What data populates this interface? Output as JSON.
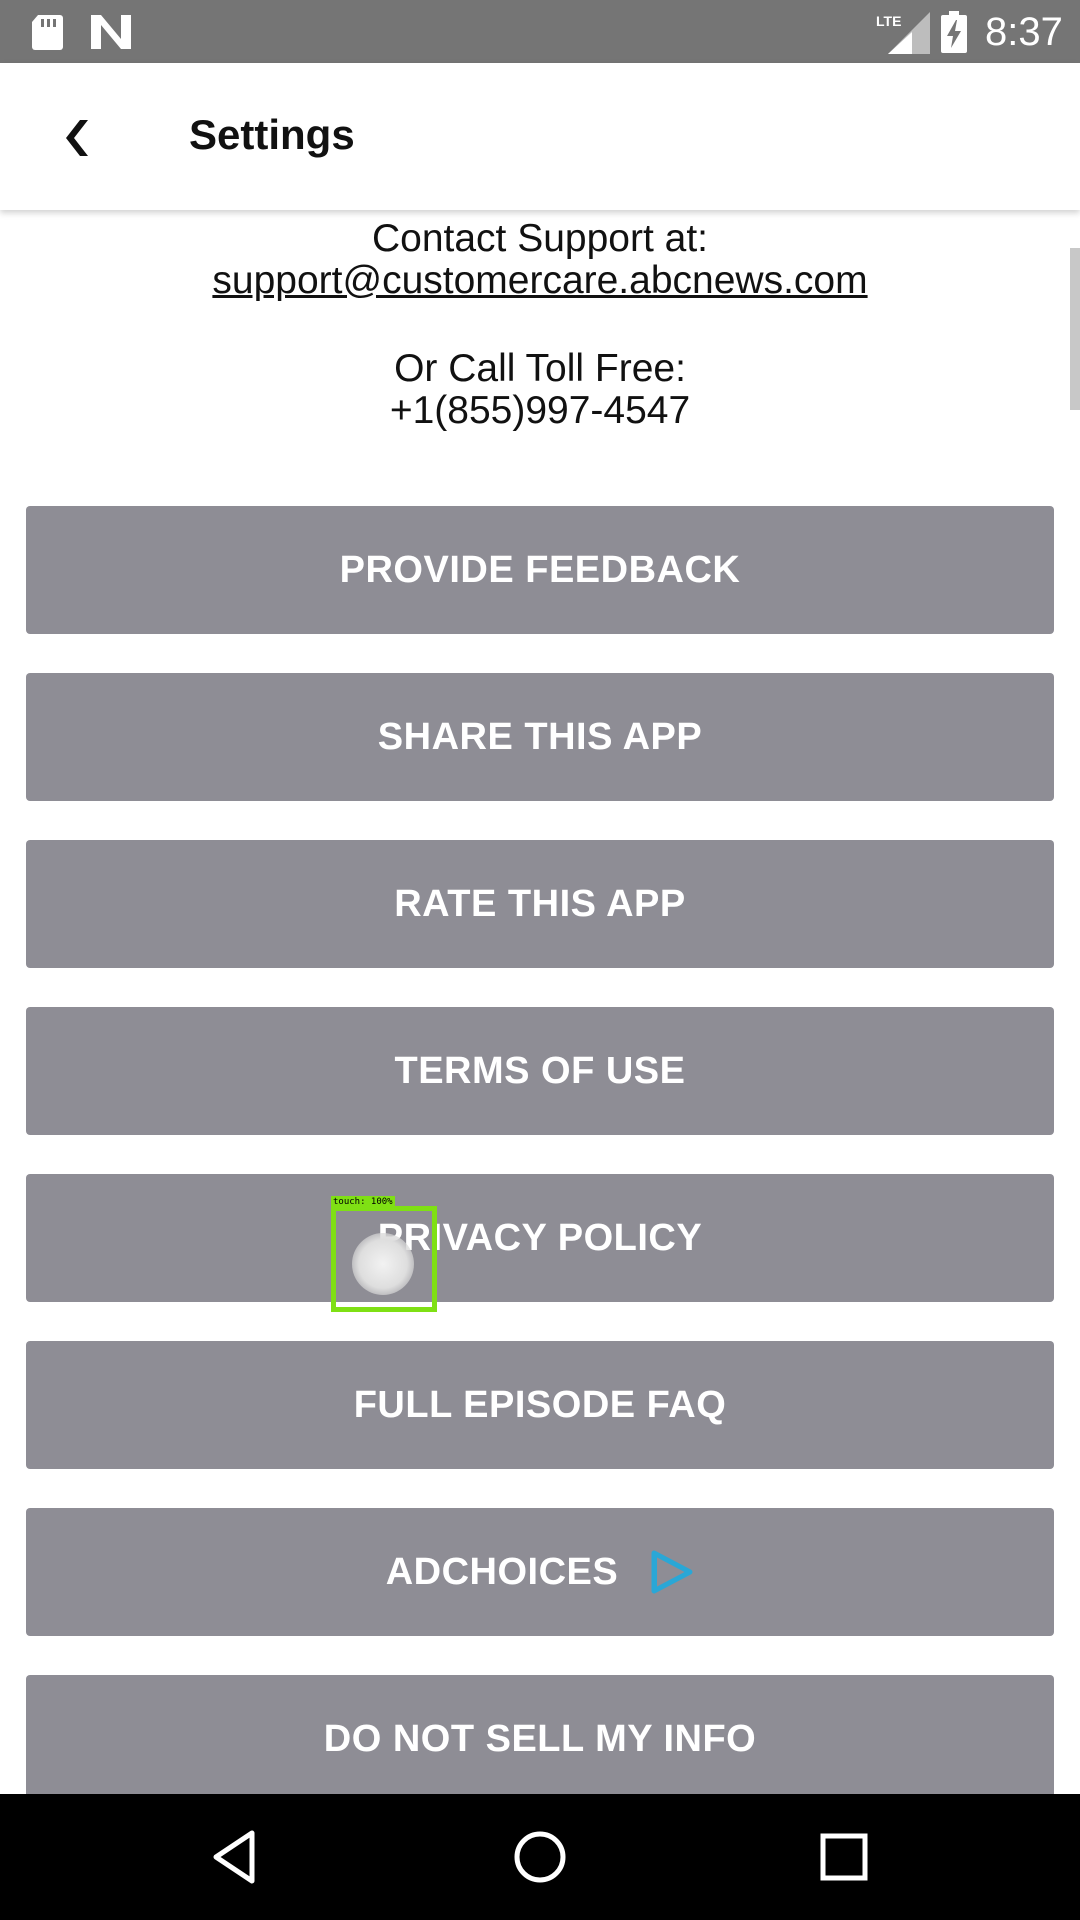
{
  "status_bar": {
    "time": "8:37",
    "network": "LTE",
    "icons": [
      "sd-card-icon",
      "n-icon",
      "lte-signal-icon",
      "battery-charging-icon"
    ]
  },
  "app_bar": {
    "title": "Settings",
    "back_icon": "chevron-left-icon"
  },
  "contact": {
    "support_label": "Contact Support at:",
    "support_email": "support@customercare.abcnews.com",
    "call_label": "Or Call Toll Free:",
    "phone": "+1(855)997-4547"
  },
  "buttons": [
    {
      "label": "PROVIDE FEEDBACK"
    },
    {
      "label": "SHARE THIS APP"
    },
    {
      "label": "RATE THIS APP"
    },
    {
      "label": "TERMS OF USE"
    },
    {
      "label": "PRIVACY POLICY"
    },
    {
      "label": "FULL EPISODE FAQ"
    },
    {
      "label": "ADCHOICES",
      "icon": "adchoices-icon"
    },
    {
      "label": "DO NOT SELL MY INFO"
    }
  ],
  "touch_indicator": {
    "label": "touch: 100%"
  },
  "colors": {
    "status_bar": "#757575",
    "button_bg": "#8e8d95",
    "button_text": "#ffffff",
    "touch_highlight": "#7fe014",
    "adchoices": "#2aa7d6"
  },
  "nav_bar": {
    "icons": [
      "back-triangle-icon",
      "home-circle-icon",
      "recents-square-icon"
    ]
  }
}
